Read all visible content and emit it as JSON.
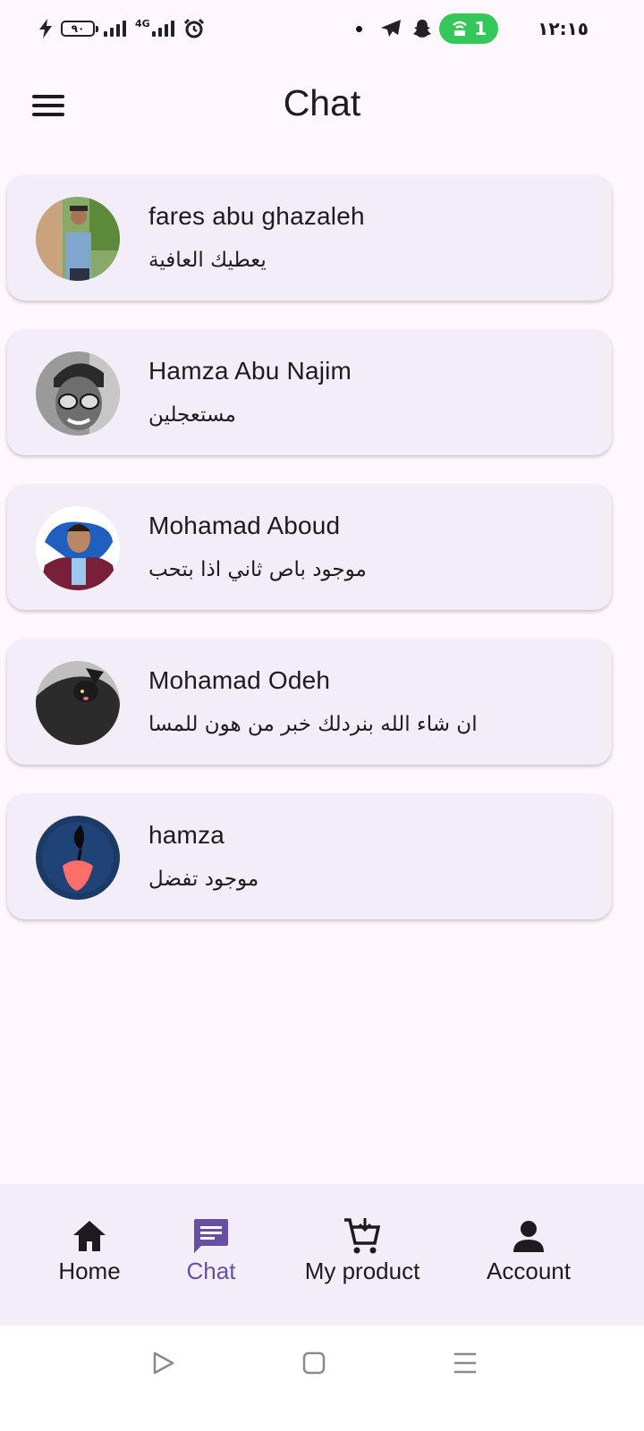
{
  "status_bar": {
    "battery_level": "٩٠",
    "network_type": "4G",
    "hotspot_count": "1",
    "time": "١٢:١٥"
  },
  "app_bar": {
    "title": "Chat"
  },
  "chats": [
    {
      "name": "fares abu ghazaleh",
      "last_message": "يعطيك العافية"
    },
    {
      "name": "Hamza Abu Najim",
      "last_message": "مستعجلين"
    },
    {
      "name": "Mohamad Aboud",
      "last_message": "موجود باص ثاني اذا بتحب"
    },
    {
      "name": "Mohamad Odeh",
      "last_message": "ان شاء الله بنردلك خبر من هون للمسا"
    },
    {
      "name": "hamza",
      "last_message": "موجود تفضل"
    }
  ],
  "bottom_nav": {
    "items": [
      {
        "label": "Home",
        "icon": "home-icon"
      },
      {
        "label": "Chat",
        "icon": "chat-icon",
        "active": true
      },
      {
        "label": "My product",
        "icon": "cart-icon"
      },
      {
        "label": "Account",
        "icon": "account-icon"
      }
    ]
  },
  "colors": {
    "background": "#fef7fd",
    "card": "#f3edf7",
    "accent": "#6750a4",
    "text": "#1d1b20",
    "hotspot": "#34c759"
  }
}
